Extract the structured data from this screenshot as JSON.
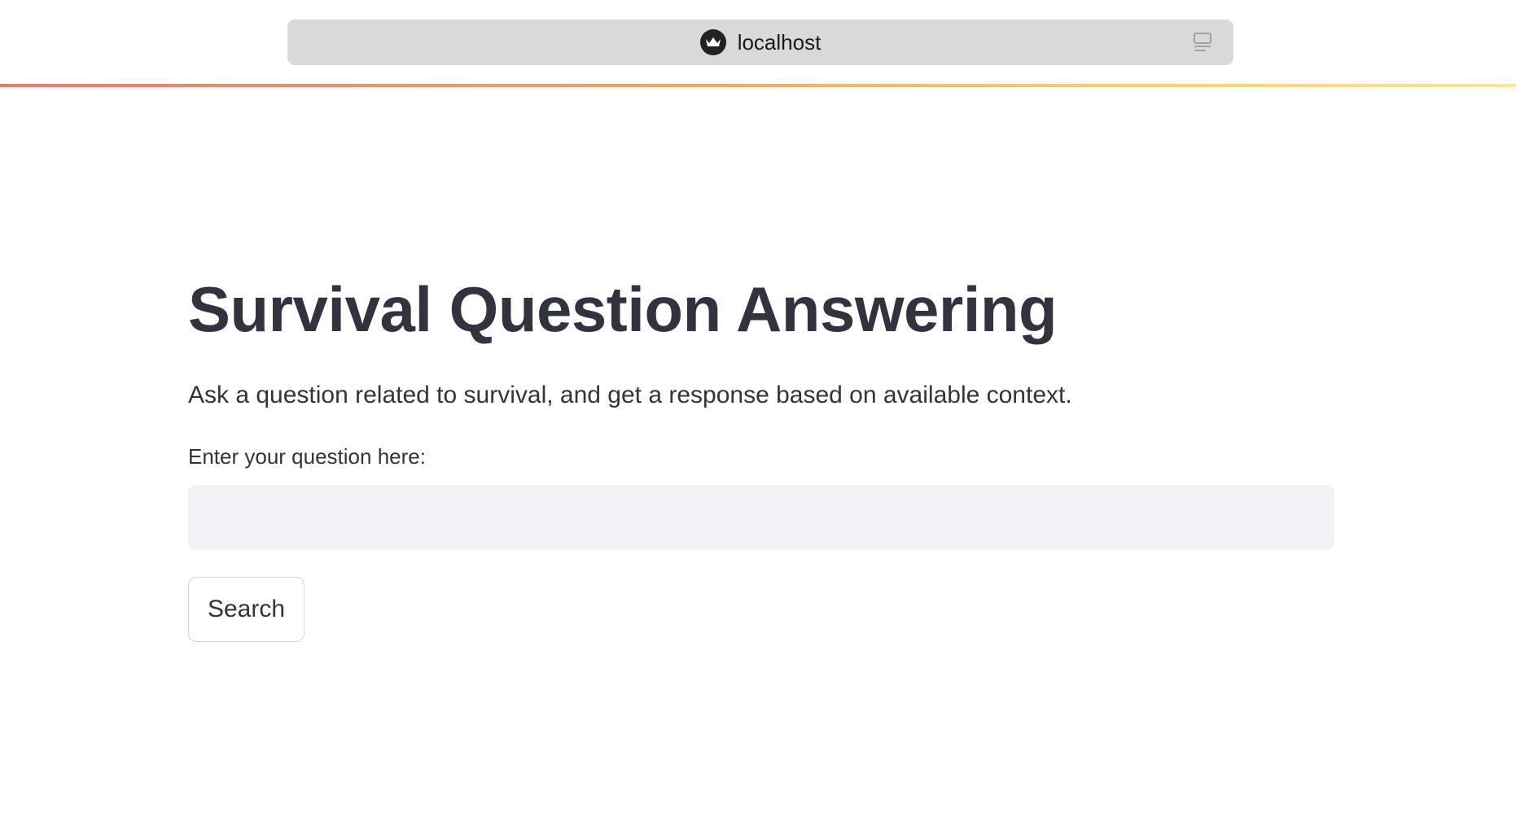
{
  "browser": {
    "url": "localhost",
    "site_icon": "crown-icon",
    "reader_icon": "reader-view-icon"
  },
  "theme": {
    "decoration_colors": [
      "#e87d65",
      "#f2a463",
      "#f8cf6e",
      "#fbe69a"
    ],
    "text_color": "#31333f",
    "input_background": "#f0f2f6"
  },
  "main": {
    "title": "Survival Question Answering",
    "subtitle": "Ask a question related to survival, and get a response based on available context.",
    "question_label": "Enter your question here:",
    "question_value": "",
    "search_label": "Search"
  }
}
